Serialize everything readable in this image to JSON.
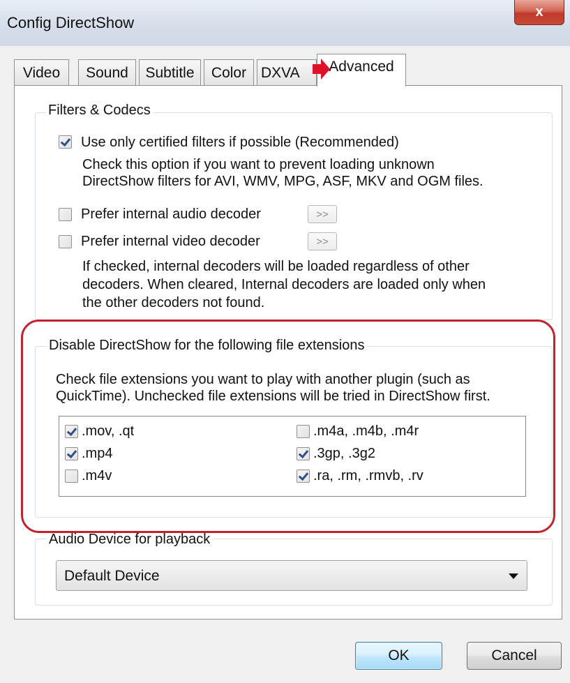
{
  "window": {
    "title": "Config DirectShow",
    "close_label": "x"
  },
  "tabs": [
    {
      "label": "Video",
      "active": false
    },
    {
      "label": "Sound",
      "active": false
    },
    {
      "label": "Subtitle",
      "active": false
    },
    {
      "label": "Color",
      "active": false
    },
    {
      "label": "DXVA",
      "active": false
    },
    {
      "label": "Advanced",
      "active": true
    }
  ],
  "filters_group": {
    "title": "Filters & Codecs",
    "certified": {
      "label": "Use only certified filters if possible (Recommended)",
      "checked": true,
      "desc_line1": "Check this option if you want to prevent loading unknown",
      "desc_line2": "DirectShow filters for AVI, WMV, MPG, ASF, MKV and OGM files."
    },
    "audio_decoder": {
      "label": "Prefer internal audio decoder",
      "checked": false,
      "button": ">>"
    },
    "video_decoder": {
      "label": "Prefer internal video decoder",
      "checked": false,
      "button": ">>"
    },
    "decoder_desc_line1": "If checked, internal decoders will be loaded regardless of other",
    "decoder_desc_line2": "decoders. When cleared, Internal decoders are loaded only when",
    "decoder_desc_line3": "the other decoders not found."
  },
  "disable_group": {
    "title": "Disable DirectShow for the following file extensions",
    "desc_line1": "Check file extensions you want to play with another plugin (such as",
    "desc_line2": "QuickTime). Unchecked file extensions will be tried in DirectShow first.",
    "extensions": [
      {
        "label": ".mov, .qt",
        "checked": true
      },
      {
        "label": ".mp4",
        "checked": true
      },
      {
        "label": ".m4v",
        "checked": false
      },
      {
        "label": ".m4a, .m4b, .m4r",
        "checked": false
      },
      {
        "label": ".3gp, .3g2",
        "checked": true
      },
      {
        "label": ".ra, .rm, .rmvb, .rv",
        "checked": true
      }
    ]
  },
  "audio_group": {
    "title": "Audio Device for playback",
    "selected": "Default Device"
  },
  "buttons": {
    "ok": "OK",
    "cancel": "Cancel"
  },
  "colors": {
    "highlight": "#c4212f",
    "arrow": "#e0102a",
    "ok_border": "#3c7fb1"
  },
  "icons": {
    "close": "close-icon",
    "arrow": "red-arrow-icon",
    "dropdown": "chevron-down-icon"
  }
}
